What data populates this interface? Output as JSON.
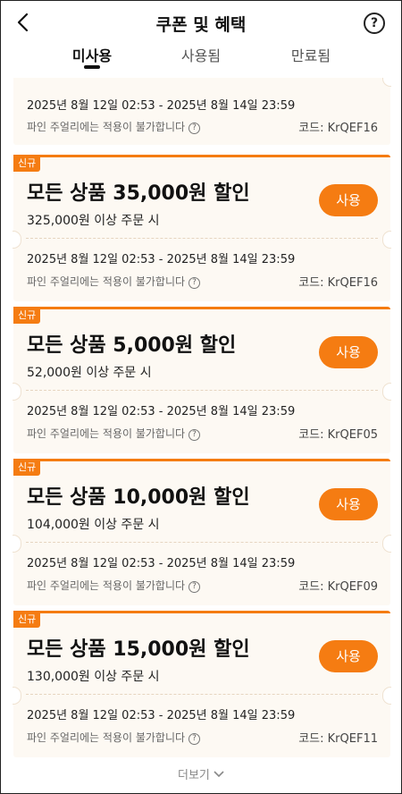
{
  "header": {
    "title": "쿠폰 및 혜택",
    "help_icon": "?"
  },
  "tabs": [
    {
      "label": "미사용",
      "active": true
    },
    {
      "label": "사용됨",
      "active": false
    },
    {
      "label": "만료됨",
      "active": false
    }
  ],
  "coupons": [
    {
      "badge": "",
      "title": "",
      "condition": "",
      "button": "",
      "period": "2025년 8월 12일 02:53 - 2025년 8월 14일 23:59",
      "notice": "파인 주얼리에는 적용이 불가합니다",
      "code": "코드: KrQEF16"
    },
    {
      "badge": "신규",
      "title": "모든 상품 35,000원 할인",
      "condition": "325,000원 이상 주문 시",
      "button": "사용",
      "period": "2025년 8월 12일 02:53 - 2025년 8월 14일 23:59",
      "notice": "파인 주얼리에는 적용이 불가합니다",
      "code": "코드: KrQEF16"
    },
    {
      "badge": "신규",
      "title": "모든 상품 5,000원 할인",
      "condition": "52,000원 이상 주문 시",
      "button": "사용",
      "period": "2025년 8월 12일 02:53 - 2025년 8월 14일 23:59",
      "notice": "파인 주얼리에는 적용이 불가합니다",
      "code": "코드: KrQEF05"
    },
    {
      "badge": "신규",
      "title": "모든 상품 10,000원 할인",
      "condition": "104,000원 이상 주문 시",
      "button": "사용",
      "period": "2025년 8월 12일 02:53 - 2025년 8월 14일 23:59",
      "notice": "파인 주얼리에는 적용이 불가합니다",
      "code": "코드: KrQEF09"
    },
    {
      "badge": "신규",
      "title": "모든 상품 15,000원 할인",
      "condition": "130,000원 이상 주문 시",
      "button": "사용",
      "period": "2025년 8월 12일 02:53 - 2025년 8월 14일 23:59",
      "notice": "파인 주얼리에는 적용이 불가합니다",
      "code": "코드: KrQEF11"
    }
  ],
  "more": {
    "label": "더보기"
  },
  "colors": {
    "accent": "#f57c12",
    "coupon_bg": "#fdf9f3"
  }
}
